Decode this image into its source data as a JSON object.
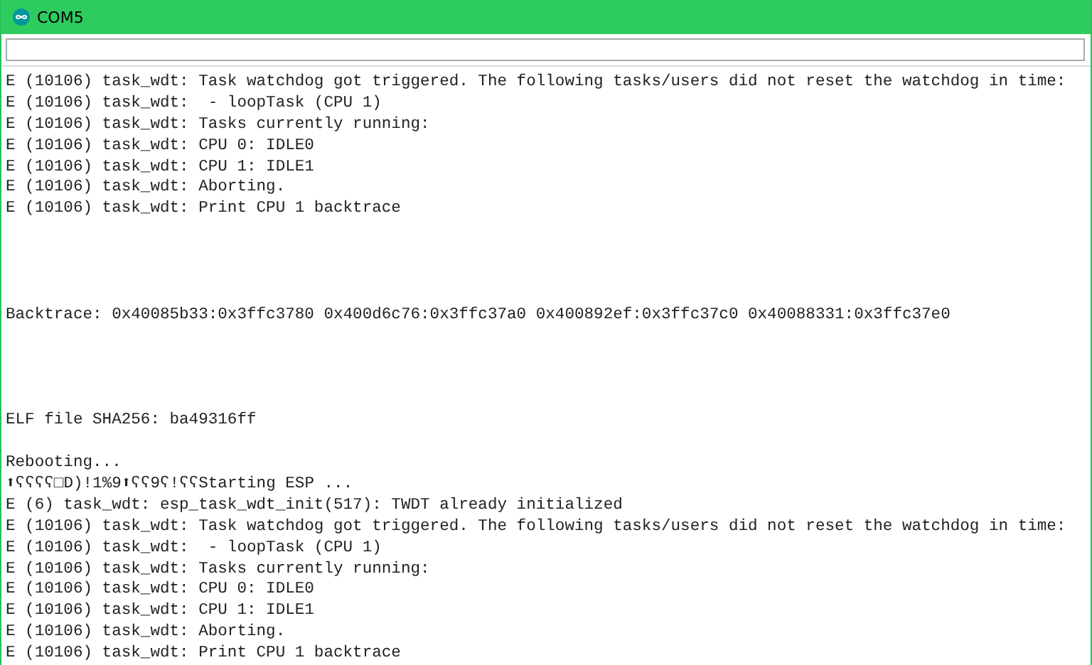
{
  "window": {
    "title": "COM5"
  },
  "log_blocks": [
    {
      "lines": [
        "E (10106) task_wdt: Task watchdog got triggered. The following tasks/users did not reset the watchdog in time:",
        "E (10106) task_wdt:  - loopTask (CPU 1)",
        "E (10106) task_wdt: Tasks currently running:",
        "E (10106) task_wdt: CPU 0: IDLE0",
        "E (10106) task_wdt: CPU 1: IDLE1",
        "E (10106) task_wdt: Aborting.",
        "E (10106) task_wdt: Print CPU 1 backtrace"
      ]
    },
    {
      "lines": [
        "Backtrace: 0x40085b33:0x3ffc3780 0x400d6c76:0x3ffc37a0 0x400892ef:0x3ffc37c0 0x40088331:0x3ffc37e0"
      ]
    },
    {
      "lines": [
        "ELF file SHA256: ba49316ff"
      ]
    },
    {
      "lines": [
        "Rebooting...",
        "⬆ʕʕʕʕ□D)!1%9⬆ʕʕ9ʕ!ʕʕStarting ESP ...",
        "E (6) task_wdt: esp_task_wdt_init(517): TWDT already initialized",
        "E (10106) task_wdt: Task watchdog got triggered. The following tasks/users did not reset the watchdog in time:",
        "E (10106) task_wdt:  - loopTask (CPU 1)",
        "E (10106) task_wdt: Tasks currently running:",
        "E (10106) task_wdt: CPU 0: IDLE0",
        "E (10106) task_wdt: CPU 1: IDLE1",
        "E (10106) task_wdt: Aborting.",
        "E (10106) task_wdt: Print CPU 1 backtrace"
      ]
    }
  ]
}
